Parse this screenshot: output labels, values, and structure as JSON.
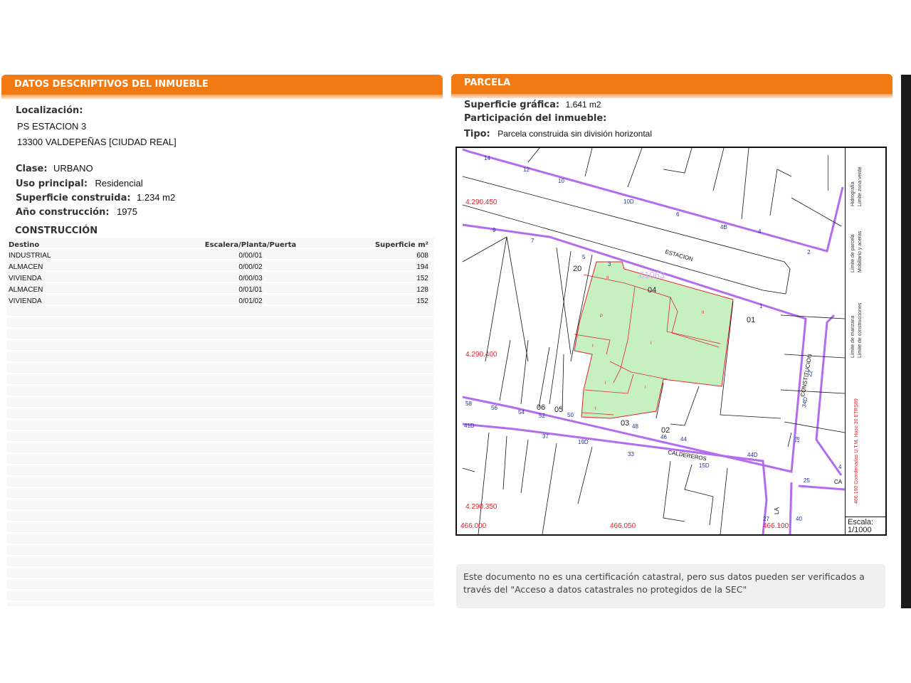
{
  "left": {
    "title": "DATOS DESCRIPTIVOS DEL INMUEBLE",
    "localizacion_label": "Localización:",
    "address_line1": "PS ESTACION 3",
    "address_line2": "13300 VALDEPEÑAS [CIUDAD REAL]",
    "clase_label": "Clase:",
    "clase_value": "URBANO",
    "uso_label": "Uso principal:",
    "uso_value": "Residencial",
    "superficie_label": "Superficie construida:",
    "superficie_value": "1.234 m2",
    "anio_label": "Año construcción:",
    "anio_value": "1975",
    "construccion_title": "CONSTRUCCIÓN",
    "table": {
      "headers": [
        "Destino",
        "Escalera/Planta/Puerta",
        "Superficie m²"
      ],
      "rows": [
        [
          "INDUSTRIAL",
          "0/00/01",
          "608"
        ],
        [
          "ALMACEN",
          "0/00/02",
          "194"
        ],
        [
          "VIVIENDA",
          "0/00/03",
          "152"
        ],
        [
          "ALMACEN",
          "0/01/01",
          "128"
        ],
        [
          "VIVIENDA",
          "0/01/02",
          "152"
        ]
      ]
    }
  },
  "right": {
    "title": "PARCELA",
    "superficie_label": "Superficie gráfica:",
    "superficie_value": "1.641 m2",
    "participacion_label": "Participación del inmueble:",
    "tipo_label": "Tipo:",
    "tipo_value": "Parcela construida sin división horizontal"
  },
  "map": {
    "coord_labels": [
      "4.290.450",
      "4.290.400",
      "4.290.350",
      "466.000",
      "466.050",
      "466.100"
    ],
    "street_labels": [
      "ESTACION",
      "CALDEREROS",
      "CONSTITUCION",
      "CA",
      "LA"
    ],
    "parcel_id": "61063",
    "parcel_numbers": [
      "20",
      "04",
      "01",
      "06",
      "05",
      "03",
      "02"
    ],
    "house_numbers": [
      "14",
      "12",
      "10",
      "10D",
      "6",
      "4B",
      "4",
      "2",
      "9",
      "7",
      "5",
      "3",
      "1",
      "58",
      "56",
      "54",
      "52",
      "50",
      "48",
      "46",
      "44",
      "44D",
      "41D",
      "37",
      "19D",
      "33",
      "15D",
      "22",
      "34D",
      "18",
      "4",
      "25",
      "27",
      "40",
      "1",
      "3"
    ],
    "floor_labels": [
      "II",
      "P",
      "I",
      "I",
      "II",
      "I",
      "I",
      "I",
      "I",
      "II"
    ],
    "legend": {
      "hidrografia": "Hidrografía",
      "zona_verde": "Límite zona verde",
      "limite_parcela": "Límite de parcela",
      "mobiliario": "Mobiliario y aceras",
      "limite_manzana": "Límite de manzana",
      "limite_construcciones": "Límite de construcciones",
      "coordenadas": "466.100 Coordenadas U.T.M. Huso 30 ETRS89"
    },
    "scale_label": "Escala:",
    "scale_value": "1/1000"
  },
  "note": {
    "text": "Este documento no es una certificación catastral, pero sus datos pueden ser verificados a través del \"Acceso a datos catastrales no protegidos de la SEC\""
  },
  "colors": {
    "header_orange": "#f27a13",
    "parcel_green": "#c6f0c0",
    "block_purple": "#b36cf0",
    "construction_red": "#e3232c"
  }
}
